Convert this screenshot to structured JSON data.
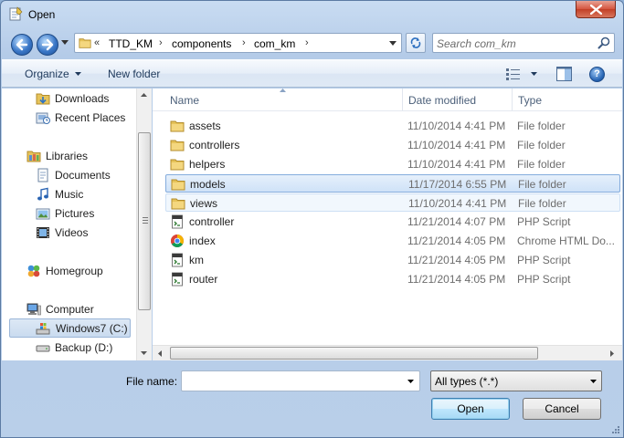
{
  "window": {
    "title": "Open"
  },
  "address": {
    "overflow": "«",
    "crumbs": [
      "TTD_KM",
      "components",
      "com_km"
    ]
  },
  "search": {
    "placeholder": "Search com_km"
  },
  "toolbar": {
    "organize": "Organize",
    "new_folder": "New folder"
  },
  "nav": {
    "items": [
      {
        "label": "Downloads",
        "icon": "downloads-folder-icon"
      },
      {
        "label": "Recent Places",
        "icon": "recent-places-icon"
      },
      {
        "label": "Libraries",
        "icon": "libraries-icon"
      },
      {
        "label": "Documents",
        "icon": "documents-icon"
      },
      {
        "label": "Music",
        "icon": "music-icon"
      },
      {
        "label": "Pictures",
        "icon": "pictures-icon"
      },
      {
        "label": "Videos",
        "icon": "videos-icon"
      },
      {
        "label": "Homegroup",
        "icon": "homegroup-icon"
      },
      {
        "label": "Computer",
        "icon": "computer-icon"
      },
      {
        "label": "Windows7 (C:)",
        "icon": "windows-drive-icon"
      },
      {
        "label": "Backup (D:)",
        "icon": "drive-icon"
      }
    ]
  },
  "columns": {
    "name": "Name",
    "date": "Date modified",
    "type": "Type"
  },
  "files": [
    {
      "name": "assets",
      "date": "11/10/2014 4:41 PM",
      "type": "File folder",
      "icon": "folder-icon"
    },
    {
      "name": "controllers",
      "date": "11/10/2014 4:41 PM",
      "type": "File folder",
      "icon": "folder-icon"
    },
    {
      "name": "helpers",
      "date": "11/10/2014 4:41 PM",
      "type": "File folder",
      "icon": "folder-icon"
    },
    {
      "name": "models",
      "date": "11/17/2014 6:55 PM",
      "type": "File folder",
      "icon": "folder-icon"
    },
    {
      "name": "views",
      "date": "11/10/2014 4:41 PM",
      "type": "File folder",
      "icon": "folder-icon"
    },
    {
      "name": "controller",
      "date": "11/21/2014 4:07 PM",
      "type": "PHP Script",
      "icon": "php-file-icon"
    },
    {
      "name": "index",
      "date": "11/21/2014 4:05 PM",
      "type": "Chrome HTML Do...",
      "icon": "chrome-html-icon"
    },
    {
      "name": "km",
      "date": "11/21/2014 4:05 PM",
      "type": "PHP Script",
      "icon": "php-file-icon"
    },
    {
      "name": "router",
      "date": "11/21/2014 4:05 PM",
      "type": "PHP Script",
      "icon": "php-file-icon"
    }
  ],
  "bottom": {
    "file_name_label": "File name:",
    "file_name_value": "",
    "file_type": "All types (*.*)",
    "open": "Open",
    "cancel": "Cancel"
  }
}
